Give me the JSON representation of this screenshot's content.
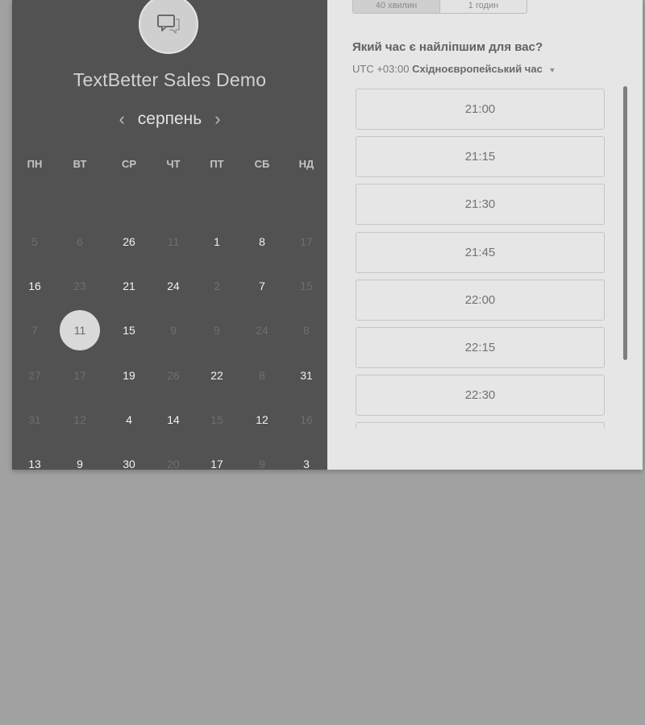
{
  "event": {
    "title": "TextBetter Sales Demo"
  },
  "calendar": {
    "month": "серпень",
    "weekdays": [
      "ПН",
      "ВТ",
      "СР",
      "ЧТ",
      "ПТ",
      "СБ",
      "НД"
    ],
    "weeks": [
      [
        {
          "d": "5",
          "a": false
        },
        {
          "d": "6",
          "a": false
        },
        {
          "d": "26",
          "a": true
        },
        {
          "d": "11",
          "a": false
        },
        {
          "d": "1",
          "a": true
        },
        {
          "d": "8",
          "a": true
        },
        {
          "d": "17",
          "a": false
        }
      ],
      [
        {
          "d": "16",
          "a": true
        },
        {
          "d": "23",
          "a": false
        },
        {
          "d": "21",
          "a": true
        },
        {
          "d": "24",
          "a": true
        },
        {
          "d": "2",
          "a": false
        },
        {
          "d": "7",
          "a": true
        },
        {
          "d": "15",
          "a": false
        }
      ],
      [
        {
          "d": "7",
          "a": false
        },
        {
          "d": "11",
          "a": true,
          "selected": true
        },
        {
          "d": "15",
          "a": true
        },
        {
          "d": "9",
          "a": false
        },
        {
          "d": "9",
          "a": false
        },
        {
          "d": "24",
          "a": false
        },
        {
          "d": "8",
          "a": false
        }
      ],
      [
        {
          "d": "27",
          "a": false
        },
        {
          "d": "17",
          "a": false
        },
        {
          "d": "19",
          "a": true
        },
        {
          "d": "26",
          "a": false
        },
        {
          "d": "22",
          "a": true
        },
        {
          "d": "8",
          "a": false
        },
        {
          "d": "31",
          "a": true
        }
      ],
      [
        {
          "d": "31",
          "a": false
        },
        {
          "d": "12",
          "a": false
        },
        {
          "d": "4",
          "a": true
        },
        {
          "d": "14",
          "a": true
        },
        {
          "d": "15",
          "a": false
        },
        {
          "d": "12",
          "a": true
        },
        {
          "d": "16",
          "a": false
        }
      ],
      [
        {
          "d": "13",
          "a": true
        },
        {
          "d": "9",
          "a": true
        },
        {
          "d": "30",
          "a": true
        },
        {
          "d": "20",
          "a": false
        },
        {
          "d": "17",
          "a": true
        },
        {
          "d": "9",
          "a": false
        },
        {
          "d": "3",
          "a": true
        }
      ]
    ]
  },
  "duration": {
    "options": [
      "40 хвилин",
      "1 годин"
    ],
    "selected": 0
  },
  "booking": {
    "question": "Який час є найліпшим для вас?",
    "tz_offset": "UTC +03:00",
    "tz_name": "Східноєвропейський час",
    "slots": [
      "21:00",
      "21:15",
      "21:30",
      "21:45",
      "22:00",
      "22:15",
      "22:30",
      ""
    ]
  },
  "icons": {
    "avatar": "chat-bubbles-icon",
    "prev": "chevron-left-icon",
    "next": "chevron-right-icon",
    "tz_caret": "caret-down-icon"
  }
}
